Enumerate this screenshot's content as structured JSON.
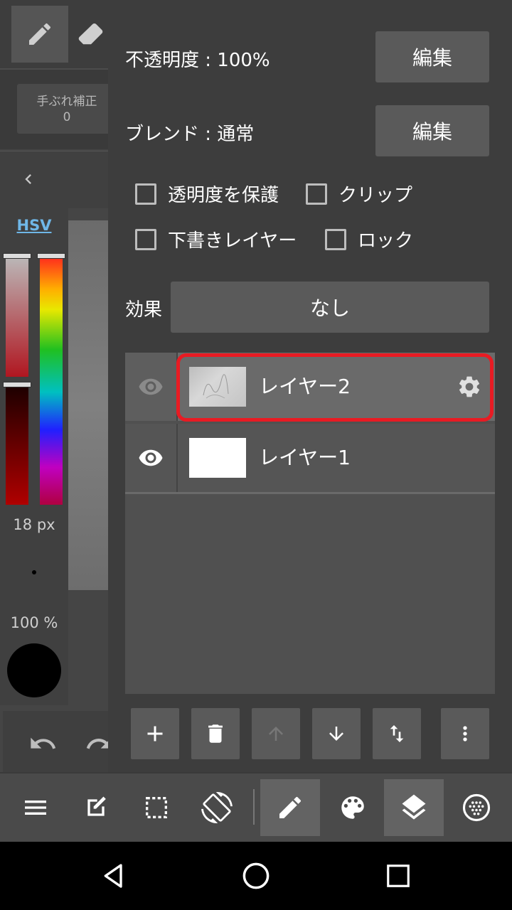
{
  "left_panel": {
    "stabilizer_label": "手ぶれ補正",
    "stabilizer_value": "0",
    "color_mode_tab": "HSV",
    "brush_size": "18 px",
    "brush_opacity": "100 %"
  },
  "layer_props": {
    "opacity_label": "不透明度 : 100%",
    "opacity_edit": "編集",
    "blend_label": "ブレンド : 通常",
    "blend_edit": "編集",
    "checkboxes": [
      {
        "label": "透明度を保護",
        "checked": false
      },
      {
        "label": "クリップ",
        "checked": false
      },
      {
        "label": "下書きレイヤー",
        "checked": false
      },
      {
        "label": "ロック",
        "checked": false
      }
    ],
    "effect_label": "効果",
    "effect_value": "なし"
  },
  "layers": [
    {
      "name": "レイヤー2",
      "selected": true,
      "visible": true
    },
    {
      "name": "レイヤー1",
      "selected": false,
      "visible": true
    }
  ],
  "colors": {
    "selection_outline": "#e81b23",
    "hsv_accent": "#6fb7e8"
  }
}
